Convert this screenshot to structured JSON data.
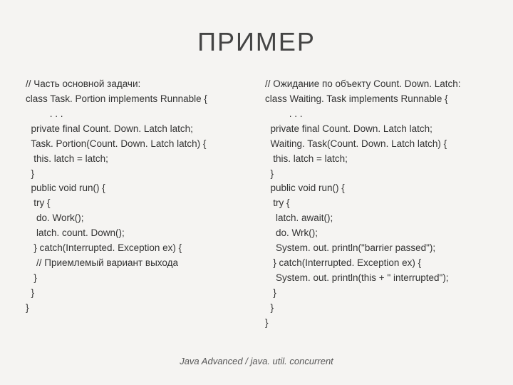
{
  "title": "ПРИМЕР",
  "left_code": "// Часть основной задачи:\nclass Task. Portion implements Runnable {\n         . . .\n  private final Count. Down. Latch latch;\n  Task. Portion(Count. Down. Latch latch) {\n   this. latch = latch;\n  }\n  public void run() {\n   try {\n    do. Work();\n    latch. count. Down();\n   } catch(Interrupted. Exception ex) {\n    // Приемлемый вариант выхода\n   }\n  }\n}",
  "right_code": "// Ожидание по объекту Count. Down. Latch:\nclass Waiting. Task implements Runnable {\n         . . .\n  private final Count. Down. Latch latch;\n  Waiting. Task(Count. Down. Latch latch) {\n   this. latch = latch;\n  }\n  public void run() {\n   try {\n    latch. await();\n    do. Wrk();\n    System. out. println(\"barrier passed\");\n   } catch(Interrupted. Exception ex) {\n    System. out. println(this + \" interrupted\");\n   }\n  }\n}",
  "footer": "Java Advanced / java. util. concurrent"
}
